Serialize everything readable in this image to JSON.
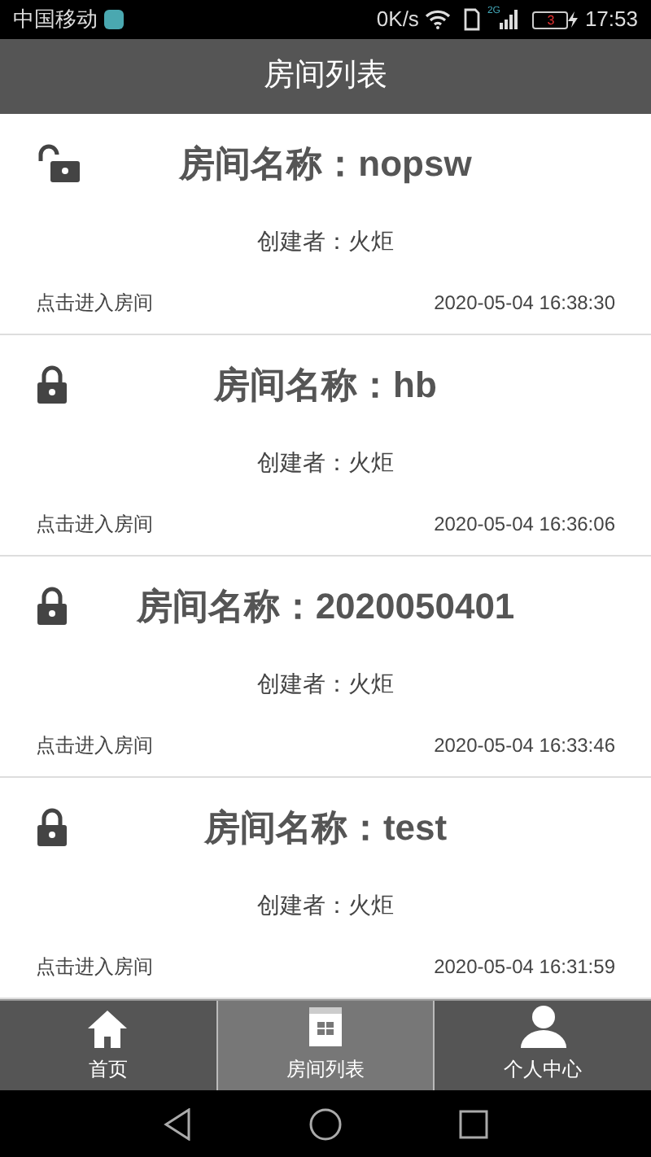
{
  "status_bar": {
    "carrier": "中国移动",
    "speed": "0K/s",
    "network": "2G",
    "battery": "3",
    "time": "17:53"
  },
  "header": {
    "title": "房间列表"
  },
  "rooms": [
    {
      "name": "房间名称：nopsw",
      "locked": false,
      "creator": "创建者：火炬",
      "action": "点击进入房间",
      "time": "2020-05-04 16:38:30"
    },
    {
      "name": "房间名称：hb",
      "locked": true,
      "creator": "创建者：火炬",
      "action": "点击进入房间",
      "time": "2020-05-04 16:36:06"
    },
    {
      "name": "房间名称：2020050401",
      "locked": true,
      "creator": "创建者：火炬",
      "action": "点击进入房间",
      "time": "2020-05-04 16:33:46"
    },
    {
      "name": "房间名称：test",
      "locked": true,
      "creator": "创建者：火炬",
      "action": "点击进入房间",
      "time": "2020-05-04 16:31:59"
    }
  ],
  "nav": [
    {
      "label": "首页",
      "kind": "home",
      "selected": false
    },
    {
      "label": "房间列表",
      "kind": "list",
      "selected": true
    },
    {
      "label": "个人中心",
      "kind": "person",
      "selected": false
    }
  ]
}
